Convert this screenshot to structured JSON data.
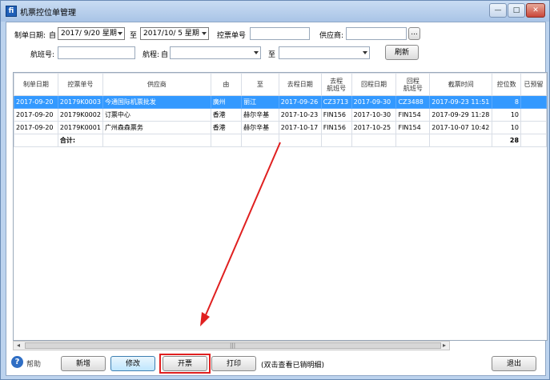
{
  "window": {
    "title": "机票控位单管理",
    "controls": {
      "minimize": "—",
      "maximize": "□",
      "close": "✕"
    },
    "app_icon": "fi"
  },
  "filters": {
    "make_date_label": "制单日期:",
    "from_label": "自",
    "from_date": "2017/ 9/20 星期",
    "to_label": "至",
    "to_date": "2017/10/ 5 星期",
    "order_no_label": "控票单号",
    "order_no_value": "",
    "supplier_label": "供应商:",
    "supplier_value": "",
    "supplier_browse": "...",
    "flight_no_label": "航班号:",
    "flight_no_value": "",
    "route_label": "航程:",
    "route_from_label": "自",
    "route_from_value": "",
    "route_to_label": "至",
    "route_to_value": "",
    "refresh_label": "刷新"
  },
  "table": {
    "columns": [
      "制单日期",
      "控票单号",
      "供应商",
      "由",
      "至",
      "去程日期",
      "去程\n航班号",
      "回程日期",
      "回程\n航班号",
      "截票时间",
      "控位数",
      "已预留"
    ],
    "rows": [
      [
        "2017-09-20",
        "20179K0003",
        "今通国际机票批发",
        "廣州",
        "丽江",
        "2017-09-26",
        "CZ3713",
        "2017-09-30",
        "CZ3488",
        "2017-09-23 11:51",
        "8",
        ""
      ],
      [
        "2017-09-20",
        "20179K0002",
        "订票中心",
        "香港",
        "赫尔辛基",
        "2017-10-23",
        "FIN156",
        "2017-10-30",
        "FIN154",
        "2017-09-29 11:28",
        "10",
        ""
      ],
      [
        "2017-09-20",
        "20179K0001",
        "广州森森票务",
        "香港",
        "赫尔辛基",
        "2017-10-17",
        "FIN156",
        "2017-10-25",
        "FIN154",
        "2017-10-07 10:42",
        "10",
        ""
      ]
    ],
    "selected_row": 0,
    "total_label": "合计:",
    "total_count": "28"
  },
  "footer": {
    "help_label": "帮助",
    "help_icon": "?",
    "add_label": "新增",
    "edit_label": "修改",
    "issue_label": "开票",
    "print_label": "打印",
    "hint": "(双击查看已销明细)",
    "exit_label": "退出"
  },
  "scrollbar": {
    "left": "◂",
    "right": "▸",
    "grip": "|||"
  },
  "colors": {
    "selection": "#3399ff",
    "annotation": "#e02020"
  }
}
